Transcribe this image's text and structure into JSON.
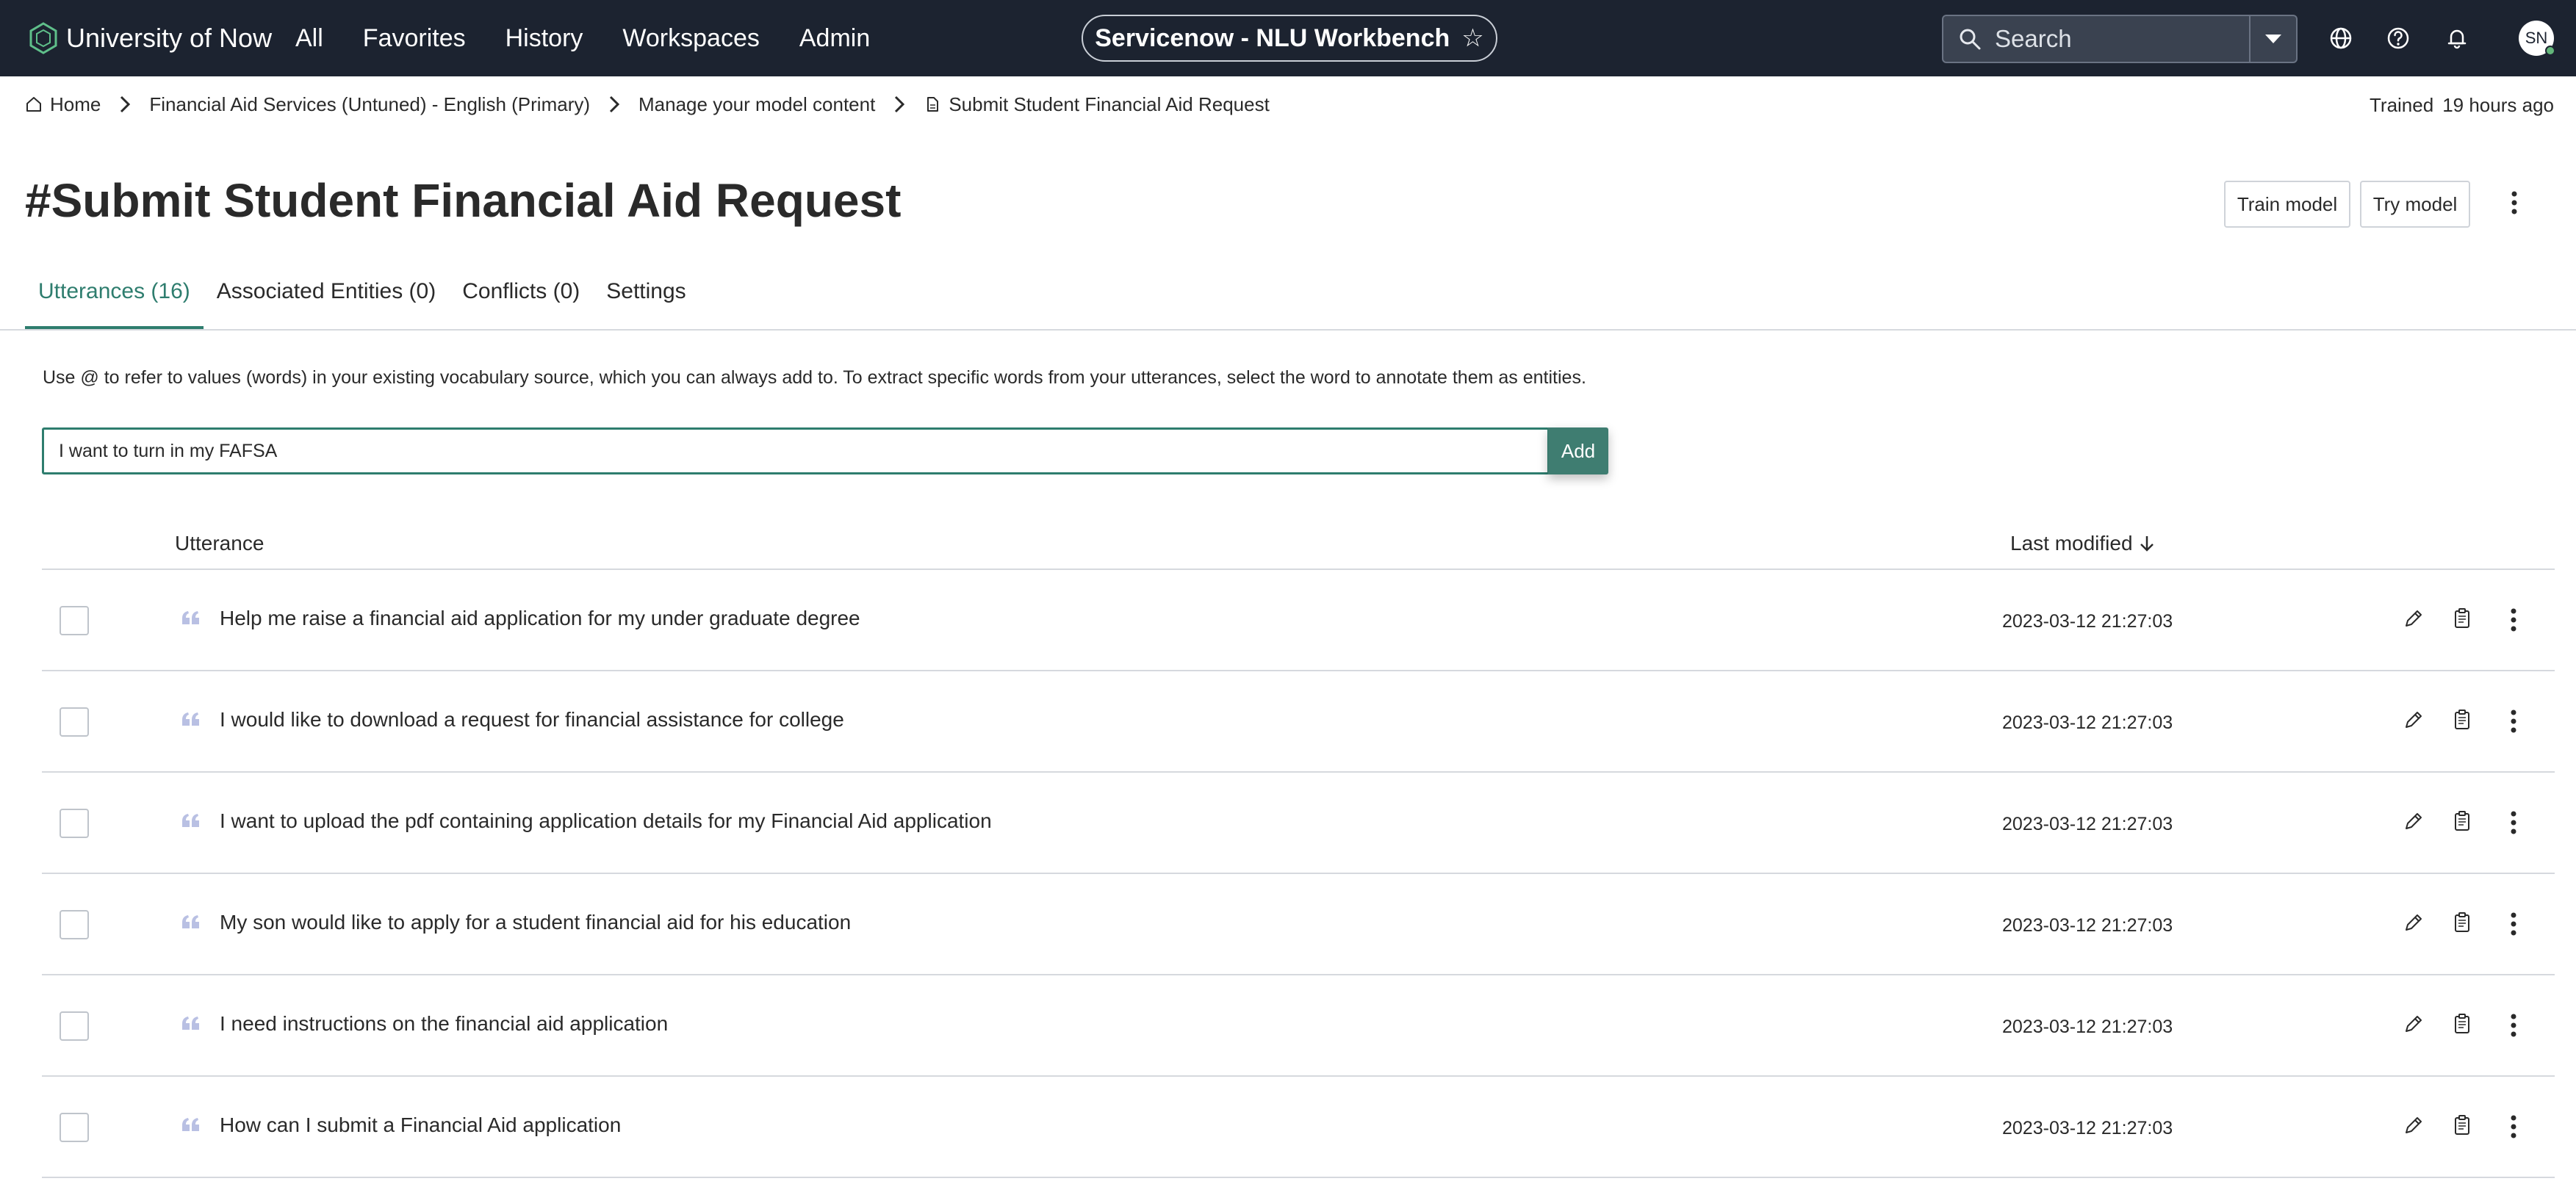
{
  "nav": {
    "brand": "University of Now",
    "links": [
      "All",
      "Favorites",
      "History",
      "Workspaces",
      "Admin"
    ],
    "app_title": "Servicenow - NLU Workbench",
    "search_placeholder": "Search",
    "avatar_initials": "SN"
  },
  "breadcrumb": {
    "items": [
      "Home",
      "Financial Aid Services (Untuned) - English (Primary)",
      "Manage your model content",
      "Submit Student Financial Aid Request"
    ]
  },
  "status": {
    "label": "Trained",
    "value": "19 hours ago"
  },
  "page": {
    "title": "#Submit Student Financial Aid Request",
    "train_button": "Train model",
    "try_button": "Try model"
  },
  "tabs": [
    "Utterances (16)",
    "Associated Entities (0)",
    "Conflicts (0)",
    "Settings"
  ],
  "help_text": "Use @ to refer to values (words) in your existing vocabulary source, which you can always add to. To extract specific words from your utterances, select the word to annotate them as entities.",
  "add": {
    "value": "I want to turn in my FAFSA",
    "button": "Add"
  },
  "table": {
    "headers": {
      "utterance": "Utterance",
      "last_modified": "Last modified"
    },
    "rows": [
      {
        "utterance": "Help me raise a financial aid application for my under graduate degree",
        "modified": "2023-03-12 21:27:03"
      },
      {
        "utterance": "I would like to download a request for financial assistance for college",
        "modified": "2023-03-12 21:27:03"
      },
      {
        "utterance": "I want to upload the pdf containing application details for my Financial Aid application",
        "modified": "2023-03-12 21:27:03"
      },
      {
        "utterance": "My son would like to apply for a student financial aid for his education",
        "modified": "2023-03-12 21:27:03"
      },
      {
        "utterance": "I need instructions on the financial aid application",
        "modified": "2023-03-12 21:27:03"
      },
      {
        "utterance": "How can I submit a Financial Aid application",
        "modified": "2023-03-12 21:27:03"
      }
    ]
  },
  "colors": {
    "nav_bg": "#1c2330",
    "accent": "#2e7d6e",
    "add_button": "#3f7d71",
    "divider": "#d6d9de"
  }
}
